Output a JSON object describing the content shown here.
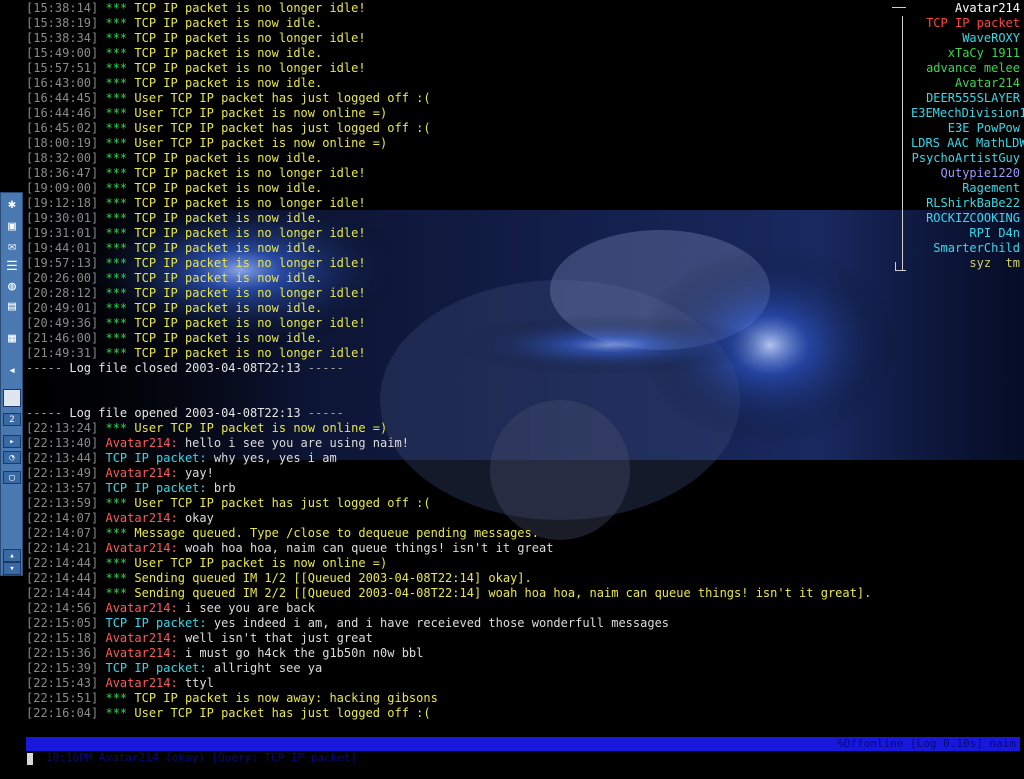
{
  "log": [
    {
      "ts": "[15:38:14]",
      "stars": "***",
      "parts": [
        [
          "sys",
          "TCP IP packet is no longer idle!"
        ]
      ]
    },
    {
      "ts": "[15:38:19]",
      "stars": "***",
      "parts": [
        [
          "sys",
          "TCP IP packet is now idle."
        ]
      ]
    },
    {
      "ts": "[15:38:34]",
      "stars": "***",
      "parts": [
        [
          "sys",
          "TCP IP packet is no longer idle!"
        ]
      ]
    },
    {
      "ts": "[15:49:00]",
      "stars": "***",
      "parts": [
        [
          "sys",
          "TCP IP packet is now idle."
        ]
      ]
    },
    {
      "ts": "[15:57:51]",
      "stars": "***",
      "parts": [
        [
          "sys",
          "TCP IP packet is no longer idle!"
        ]
      ]
    },
    {
      "ts": "[16:43:00]",
      "stars": "***",
      "parts": [
        [
          "sys",
          "TCP IP packet is now idle."
        ]
      ]
    },
    {
      "ts": "[16:44:45]",
      "stars": "***",
      "parts": [
        [
          "sys",
          "User TCP IP packet has just logged off :("
        ]
      ]
    },
    {
      "ts": "[16:44:46]",
      "stars": "***",
      "parts": [
        [
          "sys",
          "User TCP IP packet is now online =)"
        ]
      ]
    },
    {
      "ts": "[16:45:02]",
      "stars": "***",
      "parts": [
        [
          "sys",
          "User TCP IP packet has just logged off :("
        ]
      ]
    },
    {
      "ts": "[18:00:19]",
      "stars": "***",
      "parts": [
        [
          "sys",
          "User TCP IP packet is now online =)"
        ]
      ]
    },
    {
      "ts": "[18:32:00]",
      "stars": "***",
      "parts": [
        [
          "sys",
          "TCP IP packet is now idle."
        ]
      ]
    },
    {
      "ts": "[18:36:47]",
      "stars": "***",
      "parts": [
        [
          "sys",
          "TCP IP packet is no longer idle!"
        ]
      ]
    },
    {
      "ts": "[19:09:00]",
      "stars": "***",
      "parts": [
        [
          "sys",
          "TCP IP packet is now idle."
        ]
      ]
    },
    {
      "ts": "[19:12:18]",
      "stars": "***",
      "parts": [
        [
          "sys",
          "TCP IP packet is no longer idle!"
        ]
      ]
    },
    {
      "ts": "[19:30:01]",
      "stars": "***",
      "parts": [
        [
          "sys",
          "TCP IP packet is now idle."
        ]
      ]
    },
    {
      "ts": "[19:31:01]",
      "stars": "***",
      "parts": [
        [
          "sys",
          "TCP IP packet is no longer idle!"
        ]
      ]
    },
    {
      "ts": "[19:44:01]",
      "stars": "***",
      "parts": [
        [
          "sys",
          "TCP IP packet is now idle."
        ]
      ]
    },
    {
      "ts": "[19:57:13]",
      "stars": "***",
      "parts": [
        [
          "sys",
          "TCP IP packet is no longer idle!"
        ]
      ]
    },
    {
      "ts": "[20:26:00]",
      "stars": "***",
      "parts": [
        [
          "sys",
          "TCP IP packet is now idle."
        ]
      ]
    },
    {
      "ts": "[20:28:12]",
      "stars": "***",
      "parts": [
        [
          "sys",
          "TCP IP packet is no longer idle!"
        ]
      ]
    },
    {
      "ts": "[20:49:01]",
      "stars": "***",
      "parts": [
        [
          "sys",
          "TCP IP packet is now idle."
        ]
      ]
    },
    {
      "ts": "[20:49:36]",
      "stars": "***",
      "parts": [
        [
          "sys",
          "TCP IP packet is no longer idle!"
        ]
      ]
    },
    {
      "ts": "[21:46:00]",
      "stars": "***",
      "parts": [
        [
          "sys",
          "TCP IP packet is now idle."
        ]
      ]
    },
    {
      "ts": "[21:49:31]",
      "stars": "***",
      "parts": [
        [
          "sys",
          "TCP IP packet is no longer idle!"
        ]
      ]
    },
    {
      "sep": true,
      "parts": [
        [
          "sep",
          "-----"
        ],
        [
          "sepmsg",
          " Log file closed 2003-04-08T22:13 "
        ],
        [
          "sep",
          "-----"
        ]
      ]
    },
    {
      "blank": true,
      "parts": []
    },
    {
      "blank": true,
      "parts": []
    },
    {
      "sep": true,
      "parts": [
        [
          "sep",
          "-----"
        ],
        [
          "sepmsg",
          " Log file opened 2003-04-08T22:13 "
        ],
        [
          "sep",
          "-----"
        ]
      ]
    },
    {
      "ts": "[22:13:24]",
      "stars": "***",
      "parts": [
        [
          "sys",
          "User TCP IP packet is now online =)"
        ]
      ]
    },
    {
      "ts": "[22:13:40]",
      "parts": [
        [
          "u-av",
          "Avatar214:"
        ],
        [
          "txt",
          " hello i see you are using naim!"
        ]
      ]
    },
    {
      "ts": "[22:13:44]",
      "parts": [
        [
          "u-tcp",
          "TCP IP packet:"
        ],
        [
          "txt",
          " why yes, yes i am"
        ]
      ]
    },
    {
      "ts": "[22:13:49]",
      "parts": [
        [
          "u-av",
          "Avatar214:"
        ],
        [
          "txt",
          " yay!"
        ]
      ]
    },
    {
      "ts": "[22:13:57]",
      "parts": [
        [
          "u-tcp",
          "TCP IP packet:"
        ],
        [
          "txt",
          " brb"
        ]
      ]
    },
    {
      "ts": "[22:13:59]",
      "stars": "***",
      "parts": [
        [
          "sys",
          "User TCP IP packet has just logged off :("
        ]
      ]
    },
    {
      "ts": "[22:14:07]",
      "parts": [
        [
          "u-av",
          "Avatar214:"
        ],
        [
          "txt",
          " okay"
        ]
      ]
    },
    {
      "ts": "[22:14:07]",
      "stars": "***",
      "parts": [
        [
          "sys",
          "Message queued. Type /close to dequeue pending messages."
        ]
      ]
    },
    {
      "ts": "[22:14:21]",
      "parts": [
        [
          "u-av",
          "Avatar214:"
        ],
        [
          "txt",
          " woah hoa hoa, naim can queue things! isn't it great"
        ]
      ]
    },
    {
      "ts": "[22:14:44]",
      "stars": "***",
      "parts": [
        [
          "sys",
          "User TCP IP packet is now online =)"
        ]
      ]
    },
    {
      "ts": "[22:14:44]",
      "stars": "***",
      "parts": [
        [
          "sys",
          "Sending queued IM 1/2 [[Queued 2003-04-08T22:14] okay]."
        ]
      ]
    },
    {
      "ts": "[22:14:44]",
      "stars": "***",
      "parts": [
        [
          "sys",
          "Sending queued IM 2/2 [[Queued 2003-04-08T22:14] woah hoa hoa, naim can queue things! isn't it great]."
        ]
      ]
    },
    {
      "ts": "[22:14:56]",
      "parts": [
        [
          "u-av",
          "Avatar214:"
        ],
        [
          "txt",
          " i see you are back"
        ]
      ]
    },
    {
      "ts": "[22:15:05]",
      "parts": [
        [
          "u-tcp",
          "TCP IP packet:"
        ],
        [
          "txt",
          " yes indeed i am, and i have receieved those wonderfull messages"
        ]
      ]
    },
    {
      "ts": "[22:15:18]",
      "parts": [
        [
          "u-av",
          "Avatar214:"
        ],
        [
          "txt",
          " well isn't that just great"
        ]
      ]
    },
    {
      "ts": "[22:15:36]",
      "parts": [
        [
          "u-av",
          "Avatar214:"
        ],
        [
          "txt",
          " i must go h4ck the g1b50n n0w bbl"
        ]
      ]
    },
    {
      "ts": "[22:15:39]",
      "parts": [
        [
          "u-tcp",
          "TCP IP packet:"
        ],
        [
          "txt",
          " allright see ya"
        ]
      ]
    },
    {
      "ts": "[22:15:43]",
      "parts": [
        [
          "u-av",
          "Avatar214:"
        ],
        [
          "txt",
          " ttyl"
        ]
      ]
    },
    {
      "ts": "[22:15:51]",
      "stars": "***",
      "parts": [
        [
          "sys",
          "TCP IP packet is now away: hacking gibsons"
        ]
      ]
    },
    {
      "ts": "[22:16:04]",
      "stars": "***",
      "parts": [
        [
          "sys",
          "User TCP IP packet has just logged off :("
        ]
      ]
    }
  ],
  "buddies": [
    {
      "name": "Avatar214",
      "cls": "hdr"
    },
    {
      "name": "TCP IP packet",
      "cls": "act"
    },
    {
      "name": "WaveROXY",
      "cls": "on"
    },
    {
      "name": "xTaCy 1911",
      "cls": "grn"
    },
    {
      "name": "advance melee",
      "cls": "grn"
    },
    {
      "name": "Avatar214",
      "cls": "grn"
    },
    {
      "name": "DEER555SLAYER",
      "cls": "on"
    },
    {
      "name": "E3EMechDivision1",
      "cls": "on"
    },
    {
      "name": "E3E PowPow",
      "cls": "on"
    },
    {
      "name": "LDRS AAC MathLDW",
      "cls": "on"
    },
    {
      "name": "PsychoArtistGuy",
      "cls": "on"
    },
    {
      "name": "Qutypie1220",
      "cls": "idle"
    },
    {
      "name": "Ragement",
      "cls": "on"
    },
    {
      "name": "RLShirkBaBe22",
      "cls": "on"
    },
    {
      "name": "ROCKIZCOOKING",
      "cls": "on"
    },
    {
      "name": "RPI D4n",
      "cls": "on"
    },
    {
      "name": "SmarterChild",
      "cls": "on"
    },
    {
      "name": "syz  tm",
      "cls": "dim"
    }
  ],
  "status": {
    "left": " 10:16PM Avatar214 (okay) [Query: TCP IP packet]",
    "right": "%Offonline [Log 0.10s] naim"
  },
  "panel_icons": [
    "kde-gear-icon",
    "terminal-icon",
    "mail-icon",
    "notes-icon",
    "browser-icon",
    "files-icon",
    "calculator-icon",
    "speaker-icon"
  ],
  "panel_icon_glyphs": [
    "✱",
    "▣",
    "✉",
    "☰",
    "◍",
    "▤",
    "▦",
    "◂"
  ],
  "colors": {
    "status_bg": "#1818dc",
    "system": "#e8e84a",
    "stars": "#2fd84a",
    "avatar": "#ff5a5a",
    "tcp": "#38d8e8"
  }
}
